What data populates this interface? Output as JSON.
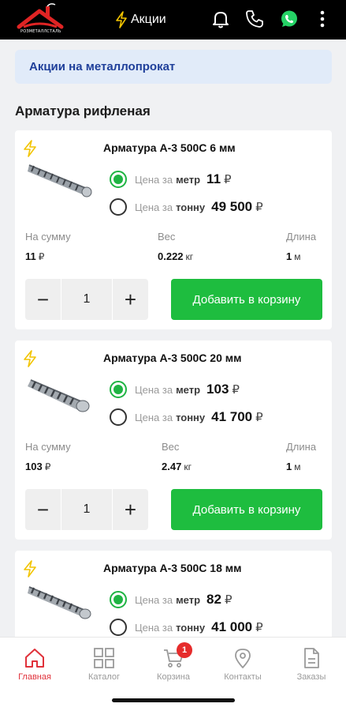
{
  "header": {
    "logo_text": "РОЗМЕТАЛЛСТАЛЬ",
    "promo_label": "Акции",
    "colors": {
      "bar": "#000000",
      "accent_red": "#e0313a",
      "whatsapp": "#25d366"
    }
  },
  "banner": {
    "text": "Акции на металлопрокат"
  },
  "section": {
    "title": "Арматура рифленая"
  },
  "labels": {
    "price_prefix": "Цена за",
    "unit_meter": "метр",
    "unit_ton": "тонну",
    "currency": "₽",
    "sum": "На сумму",
    "weight": "Вес",
    "length": "Длина",
    "kg": "кг",
    "m": "м",
    "add_to_cart": "Добавить в корзину",
    "minus": "−",
    "plus": "+"
  },
  "products": [
    {
      "title": "Арматура А-3 500С 6 мм",
      "price_meter": "11",
      "price_ton": "49 500",
      "selected": "meter",
      "sum": "11",
      "weight": "0.222",
      "length": "1",
      "qty": "1"
    },
    {
      "title": "Арматура А-3 500С 20 мм",
      "price_meter": "103",
      "price_ton": "41 700",
      "selected": "meter",
      "sum": "103",
      "weight": "2.47",
      "length": "1",
      "qty": "1"
    },
    {
      "title": "Арматура А-3 500С 18 мм",
      "price_meter": "82",
      "price_ton": "41 000",
      "selected": "meter"
    }
  ],
  "bottom_nav": {
    "items": [
      {
        "label": "Главная",
        "icon": "home-icon",
        "active": true
      },
      {
        "label": "Каталог",
        "icon": "grid-icon"
      },
      {
        "label": "Корзина",
        "icon": "cart-icon",
        "badge": "1"
      },
      {
        "label": "Контакты",
        "icon": "location-pin-icon"
      },
      {
        "label": "Заказы",
        "icon": "document-icon"
      }
    ]
  }
}
